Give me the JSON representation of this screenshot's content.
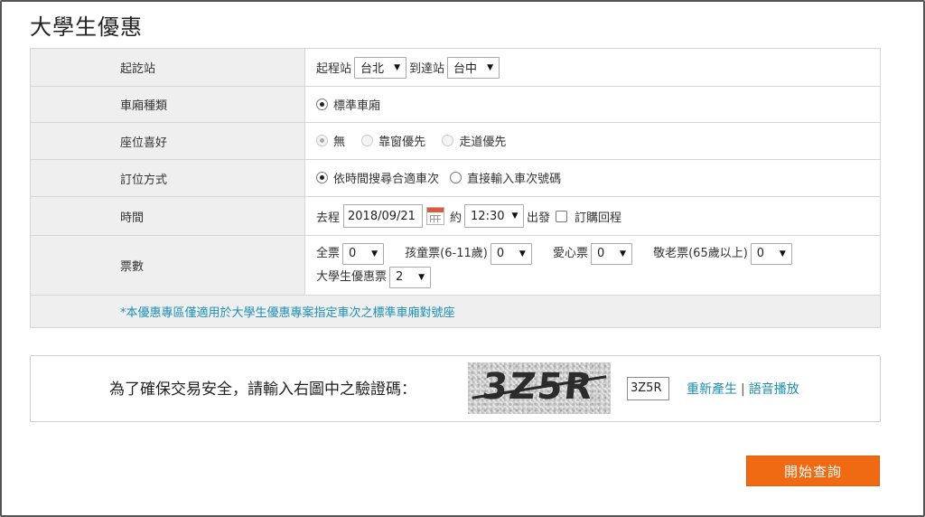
{
  "page_title": "大學生優惠",
  "form": {
    "station": {
      "label": "起訖站",
      "from_label": "起程站",
      "from_value": "台北",
      "to_label": "到達站",
      "to_value": "台中"
    },
    "car_type": {
      "label": "車廂種類",
      "option": "標準車廂"
    },
    "seat_pref": {
      "label": "座位喜好",
      "options": [
        "無",
        "靠窗優先",
        "走道優先"
      ]
    },
    "booking_method": {
      "label": "訂位方式",
      "options": [
        "依時間搜尋合適車次",
        "直接輸入車次號碼"
      ]
    },
    "time": {
      "label": "時間",
      "depart_label": "去程",
      "date": "2018/09/21",
      "about_label": "約",
      "time_value": "12:30",
      "depart_suffix": "出發",
      "return_label": "訂購回程"
    },
    "tickets": {
      "label": "票數",
      "items": [
        {
          "label": "全票",
          "value": "0"
        },
        {
          "label": "孩童票(6-11歲)",
          "value": "0"
        },
        {
          "label": "愛心票",
          "value": "0"
        },
        {
          "label": "敬老票(65歲以上)",
          "value": "0"
        },
        {
          "label": "大學生優惠票",
          "value": "2"
        }
      ]
    },
    "note": "*本優惠專區僅適用於大學生優惠專案指定車次之標準車廂對號座"
  },
  "captcha": {
    "label": "為了確保交易安全，請輸入右圖中之驗證碼：",
    "image_text": "3Z5R",
    "input_value": "3Z5R",
    "regen_link": "重新產生",
    "separator": "|",
    "audio_link": "語音播放"
  },
  "submit_label": "開始查詢"
}
